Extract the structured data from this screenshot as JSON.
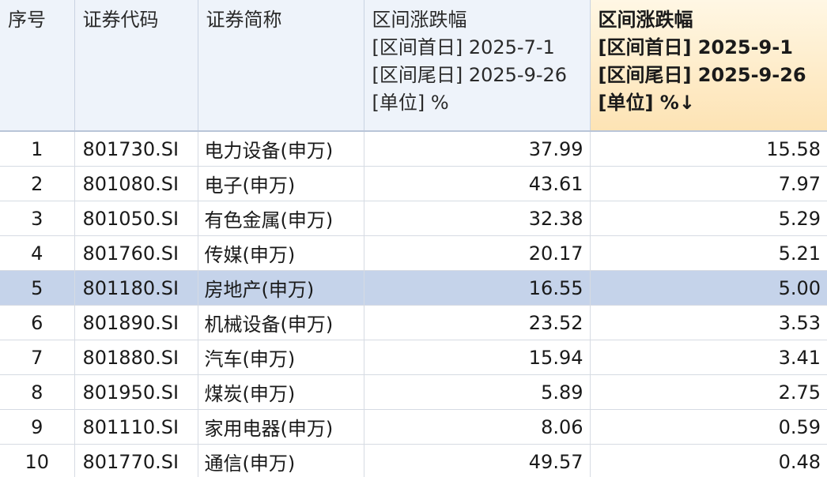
{
  "header": {
    "seq": "序号",
    "code": "证券代码",
    "name": "证券简称",
    "ret1": {
      "title": "区间涨跌幅",
      "start": "[区间首日] 2025-7-1",
      "end": "[区间尾日] 2025-9-26",
      "unit": "[单位] %"
    },
    "ret2": {
      "title": "区间涨跌幅",
      "start": "[区间首日] 2025-9-1",
      "end": "[区间尾日] 2025-9-26",
      "unit": "[单位] %",
      "sort_arrow": "↓"
    }
  },
  "selected_row": 4,
  "colors": {
    "header_bg": "#eef3fa",
    "sorted_header_bg": "#fde3b4",
    "selected_row_bg": "#c5d3ea",
    "grid_line": "#d6dbe3"
  },
  "rows": [
    {
      "seq": "1",
      "code": "801730.SI",
      "name": "电力设备(申万)",
      "ret1": "37.99",
      "ret2": "15.58"
    },
    {
      "seq": "2",
      "code": "801080.SI",
      "name": "电子(申万)",
      "ret1": "43.61",
      "ret2": "7.97"
    },
    {
      "seq": "3",
      "code": "801050.SI",
      "name": "有色金属(申万)",
      "ret1": "32.38",
      "ret2": "5.29"
    },
    {
      "seq": "4",
      "code": "801760.SI",
      "name": "传媒(申万)",
      "ret1": "20.17",
      "ret2": "5.21"
    },
    {
      "seq": "5",
      "code": "801180.SI",
      "name": "房地产(申万)",
      "ret1": "16.55",
      "ret2": "5.00"
    },
    {
      "seq": "6",
      "code": "801890.SI",
      "name": "机械设备(申万)",
      "ret1": "23.52",
      "ret2": "3.53"
    },
    {
      "seq": "7",
      "code": "801880.SI",
      "name": "汽车(申万)",
      "ret1": "15.94",
      "ret2": "3.41"
    },
    {
      "seq": "8",
      "code": "801950.SI",
      "name": "煤炭(申万)",
      "ret1": "5.89",
      "ret2": "2.75"
    },
    {
      "seq": "9",
      "code": "801110.SI",
      "name": "家用电器(申万)",
      "ret1": "8.06",
      "ret2": "0.59"
    },
    {
      "seq": "10",
      "code": "801770.SI",
      "name": "通信(申万)",
      "ret1": "49.57",
      "ret2": "0.48"
    }
  ]
}
